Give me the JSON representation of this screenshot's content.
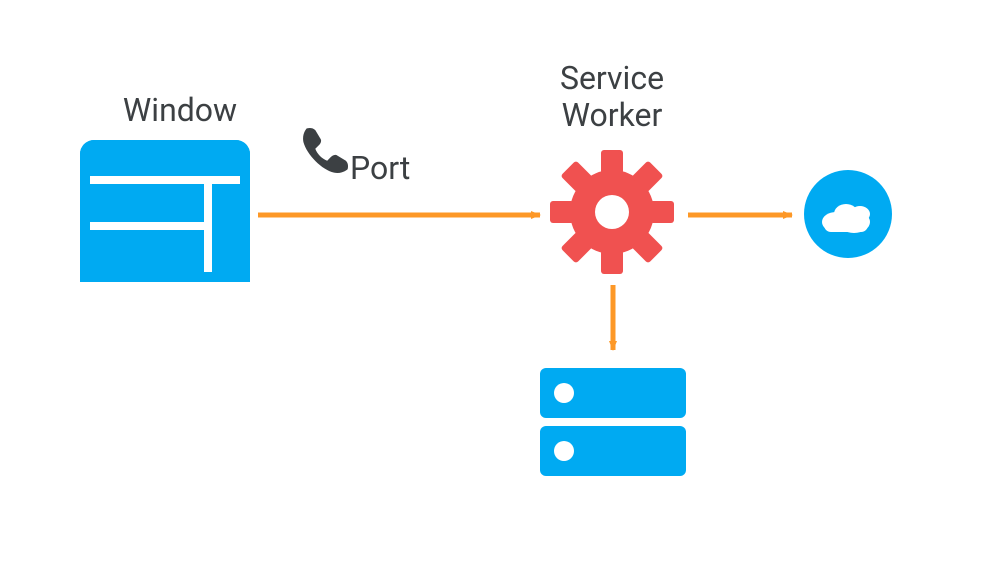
{
  "labels": {
    "window": "Window",
    "port": "Port",
    "service_worker_line1": "Service",
    "service_worker_line2": "Worker"
  },
  "colors": {
    "blue": "#00aaf2",
    "orange": "#fd9827",
    "red": "#f05150",
    "dark": "#3c4043",
    "white": "#ffffff"
  },
  "diagram": {
    "nodes": [
      {
        "id": "window",
        "type": "browser-window",
        "label_key": "labels.window"
      },
      {
        "id": "service-worker",
        "type": "gear",
        "label_key": "labels.service_worker"
      },
      {
        "id": "cache",
        "type": "storage-stack"
      },
      {
        "id": "cloud",
        "type": "cloud"
      }
    ],
    "edges": [
      {
        "from": "window",
        "to": "service-worker",
        "label_key": "labels.port",
        "icon": "phone"
      },
      {
        "from": "service-worker",
        "to": "cache"
      },
      {
        "from": "service-worker",
        "to": "cloud"
      }
    ]
  }
}
